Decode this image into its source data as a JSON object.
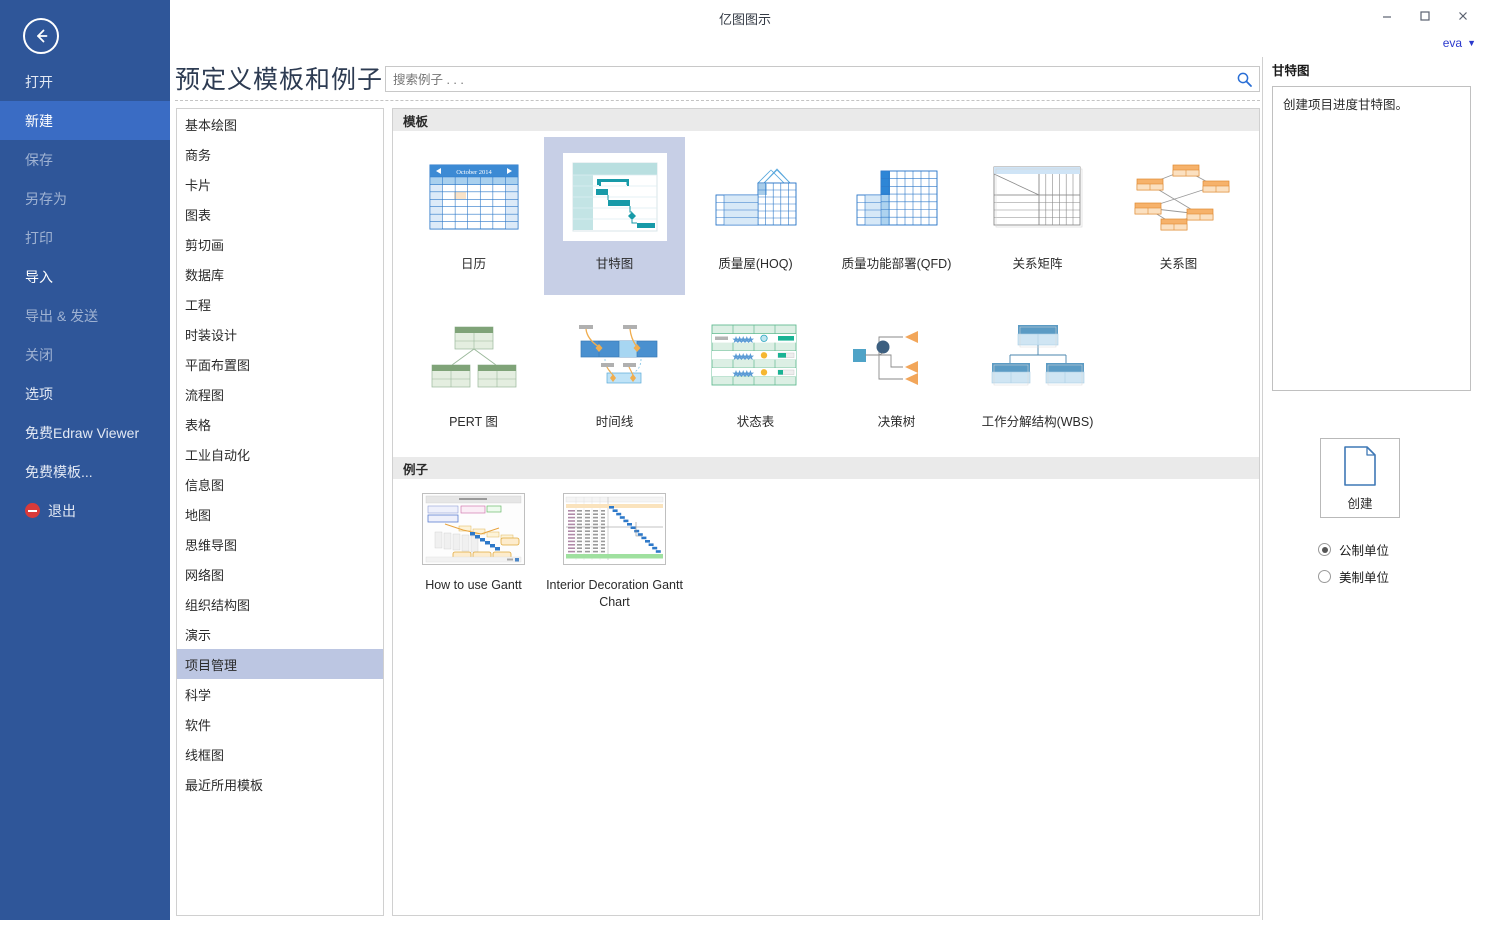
{
  "window": {
    "title": "亿图图示",
    "minimize_label": "–",
    "maximize_label": "□",
    "close_label": "✕",
    "user": "eva"
  },
  "rail": {
    "back_icon": "back-arrow-icon",
    "items": [
      {
        "label": "打开",
        "state": "normal"
      },
      {
        "label": "新建",
        "state": "active"
      },
      {
        "label": "保存",
        "state": "dim"
      },
      {
        "label": "另存为",
        "state": "dim"
      },
      {
        "label": "打印",
        "state": "dim"
      },
      {
        "label": "导入",
        "state": "strong"
      },
      {
        "label": "导出 & 发送",
        "state": "dim"
      },
      {
        "label": "关闭",
        "state": "dim"
      },
      {
        "label": "选项",
        "state": "normal"
      },
      {
        "label": "免费Edraw Viewer",
        "state": "normal"
      },
      {
        "label": "免费模板...",
        "state": "normal"
      },
      {
        "label": "退出",
        "state": "exit"
      }
    ]
  },
  "header": {
    "title": "预定义模板和例子",
    "search_placeholder": "搜索例子 . . .",
    "search_value": ""
  },
  "categories": {
    "selected": "项目管理",
    "items": [
      "基本绘图",
      "商务",
      "卡片",
      "图表",
      "剪切画",
      "数据库",
      "工程",
      "时装设计",
      "平面布置图",
      "流程图",
      "表格",
      "工业自动化",
      "信息图",
      "地图",
      "思维导图",
      "网络图",
      "组织结构图",
      "演示",
      "项目管理",
      "科学",
      "软件",
      "线框图",
      "最近所用模板"
    ]
  },
  "main": {
    "templates_heading": "模板",
    "examples_heading": "例子",
    "templates": [
      {
        "label": "日历",
        "thumb": "calendar-thumb",
        "selected": false,
        "caption": "October 2014"
      },
      {
        "label": "甘特图",
        "thumb": "gantt-thumb",
        "selected": true
      },
      {
        "label": "质量屋(HOQ)",
        "thumb": "hoq-thumb",
        "selected": false
      },
      {
        "label": "质量功能部署(QFD)",
        "thumb": "qfd-thumb",
        "selected": false
      },
      {
        "label": "关系矩阵",
        "thumb": "matrix-thumb",
        "selected": false
      },
      {
        "label": "关系图",
        "thumb": "relation-thumb",
        "selected": false
      },
      {
        "label": "PERT 图",
        "thumb": "pert-thumb",
        "selected": false
      },
      {
        "label": "时间线",
        "thumb": "timeline-thumb",
        "selected": false
      },
      {
        "label": "状态表",
        "thumb": "status-thumb",
        "selected": false
      },
      {
        "label": "决策树",
        "thumb": "decision-thumb",
        "selected": false
      },
      {
        "label": "工作分解结构(WBS)",
        "thumb": "wbs-thumb",
        "selected": false
      }
    ],
    "examples": [
      {
        "label": "How to use Gantt",
        "thumb": "how-to-use-gantt-thumb"
      },
      {
        "label": "Interior Decoration Gantt Chart",
        "thumb": "interior-decoration-gantt-thumb"
      }
    ]
  },
  "right": {
    "title": "甘特图",
    "description": "创建项目进度甘特图。",
    "create_label": "创建",
    "create_icon": "new-document-icon",
    "units": [
      {
        "label": "公制单位",
        "checked": true
      },
      {
        "label": "美制单位",
        "checked": false
      }
    ]
  },
  "colors": {
    "rail_bg": "#2f5699",
    "rail_active": "#3a6cc4",
    "selection": "#c7cfe6",
    "category_selection": "#bcc6e2",
    "accent_link": "#2b39cc",
    "section_head_bg": "#eaeaea"
  }
}
